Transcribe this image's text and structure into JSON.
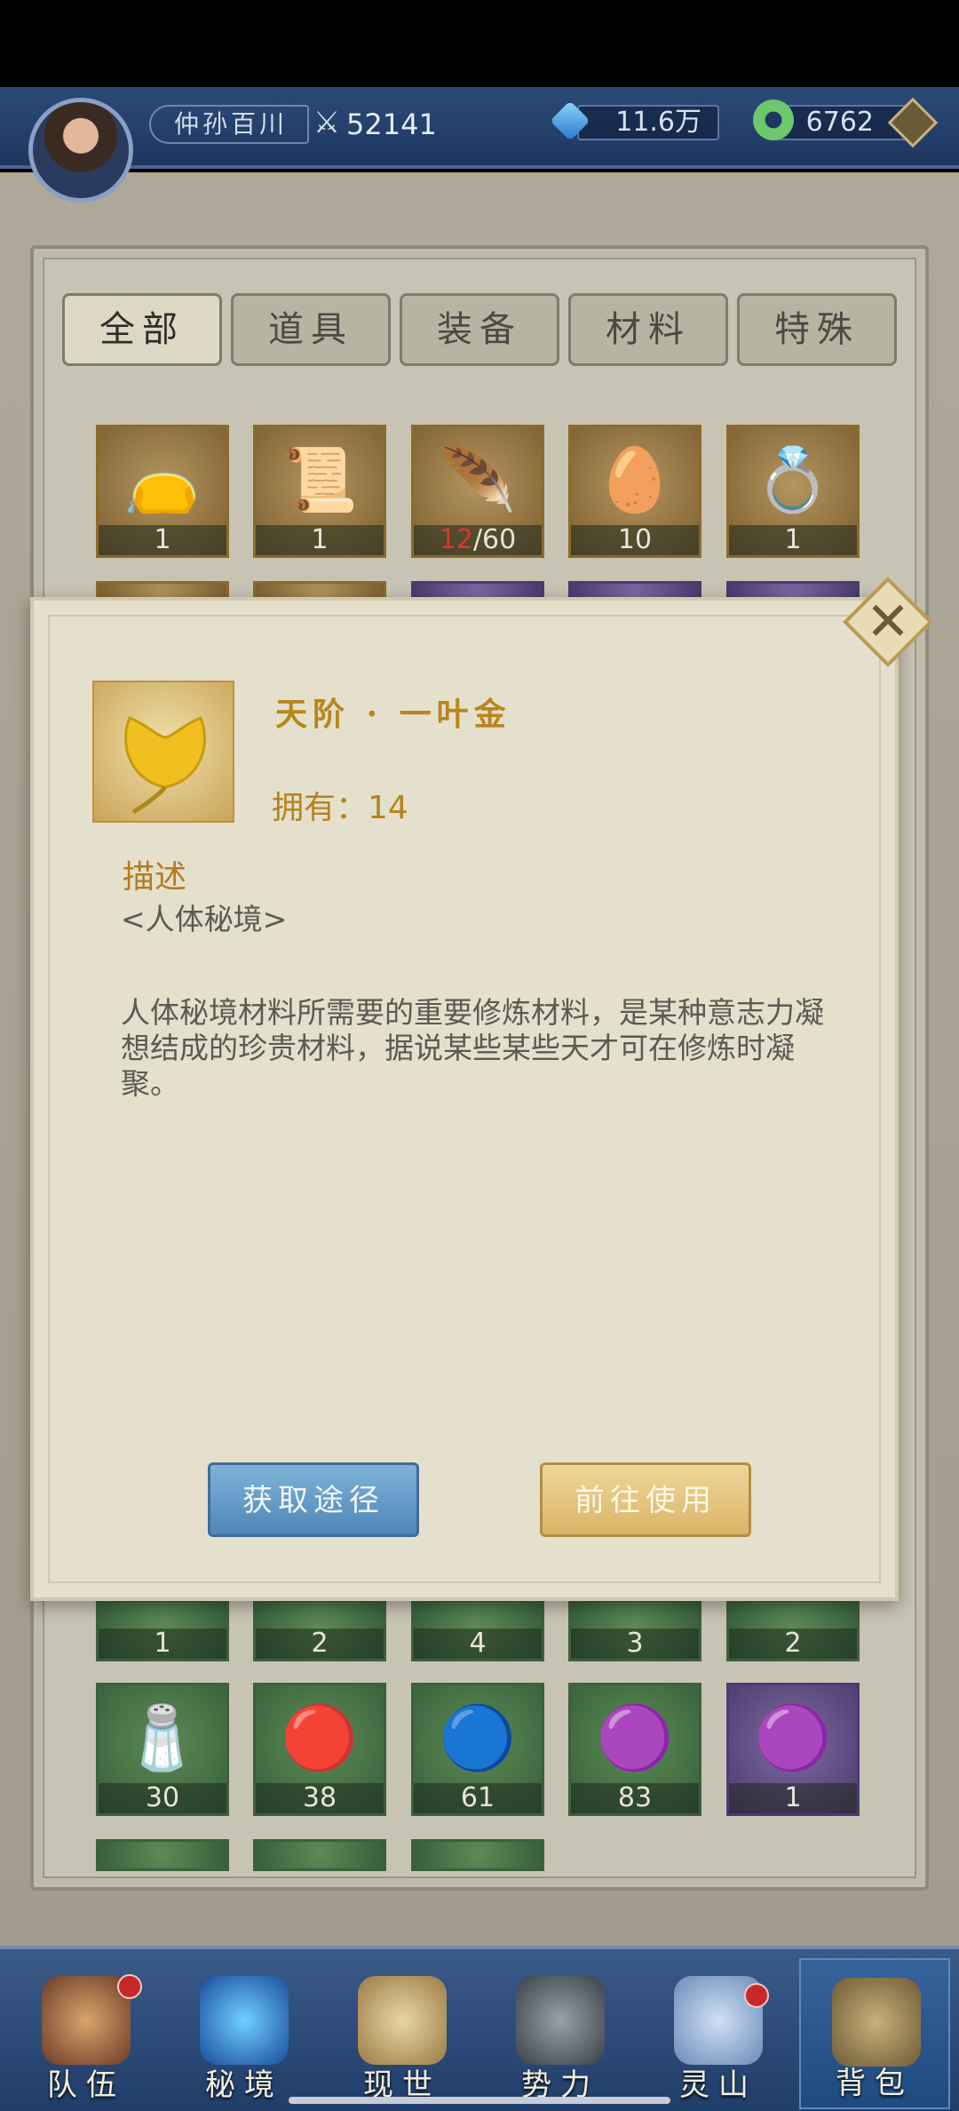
{
  "player": {
    "name": "仲孙百川",
    "power": "52141",
    "crystal": "11.6万",
    "jade": "6762"
  },
  "tabs": [
    "全部",
    "道具",
    "装备",
    "材料",
    "特殊"
  ],
  "grid": {
    "row1_counts": [
      "1",
      "1",
      "12",
      "/60",
      "10",
      "1"
    ],
    "row_under_dialog_counts": [
      "1",
      "2",
      "4",
      "3",
      "2"
    ],
    "row_green_counts": [
      "30",
      "38",
      "61",
      "83",
      "1"
    ]
  },
  "dialog": {
    "item_name": "天阶 · 一叶金",
    "owned": "拥有：14",
    "desc_title": "描述",
    "desc_sub": "<人体秘境>",
    "desc_body": "人体秘境材料所需要的重要修炼材料，是某种意志力凝想结成的珍贵材料，据说某些某些天才可在修炼时凝聚。",
    "btn_source": "获取途径",
    "btn_use": "前往使用"
  },
  "nav": [
    "队伍",
    "秘境",
    "现世",
    "势力",
    "灵山",
    "背包"
  ],
  "colors": {
    "item_name": "#b8861a",
    "accent_blue": "#4f86b8",
    "accent_gold": "#d9b468",
    "badge_red": "#c8282a"
  }
}
